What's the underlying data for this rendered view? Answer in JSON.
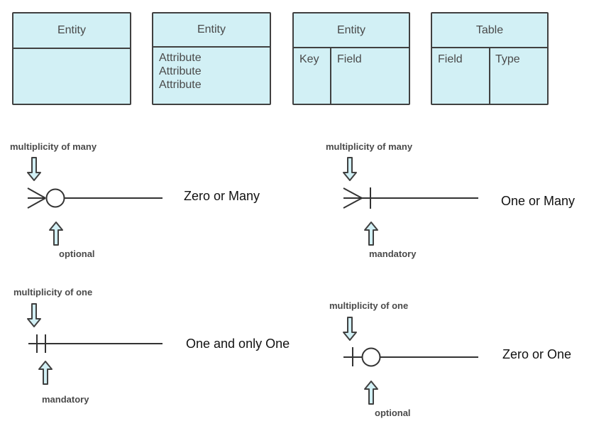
{
  "colors": {
    "fill": "#d2f0f5",
    "stroke": "#404040",
    "text": "#4a4a4a",
    "label_text": "#111111"
  },
  "shapes": {
    "entity_empty": {
      "title": "Entity"
    },
    "entity_attributes": {
      "title": "Entity",
      "attributes": [
        "Attribute",
        "Attribute",
        "Attribute"
      ]
    },
    "entity_key_field": {
      "title": "Entity",
      "col1": "Key",
      "col2": "Field"
    },
    "table": {
      "title": "Table",
      "col1": "Field",
      "col2": "Type"
    }
  },
  "notations": [
    {
      "name": "Zero or Many",
      "top_label": "multiplicity of many",
      "bottom_label": "optional"
    },
    {
      "name": "One or Many",
      "top_label": "multiplicity of many",
      "bottom_label": "mandatory"
    },
    {
      "name": "One and only One",
      "top_label": "multiplicity of one",
      "bottom_label": "mandatory"
    },
    {
      "name": "Zero or One",
      "top_label": "multiplicity of one",
      "bottom_label": "optional"
    }
  ]
}
